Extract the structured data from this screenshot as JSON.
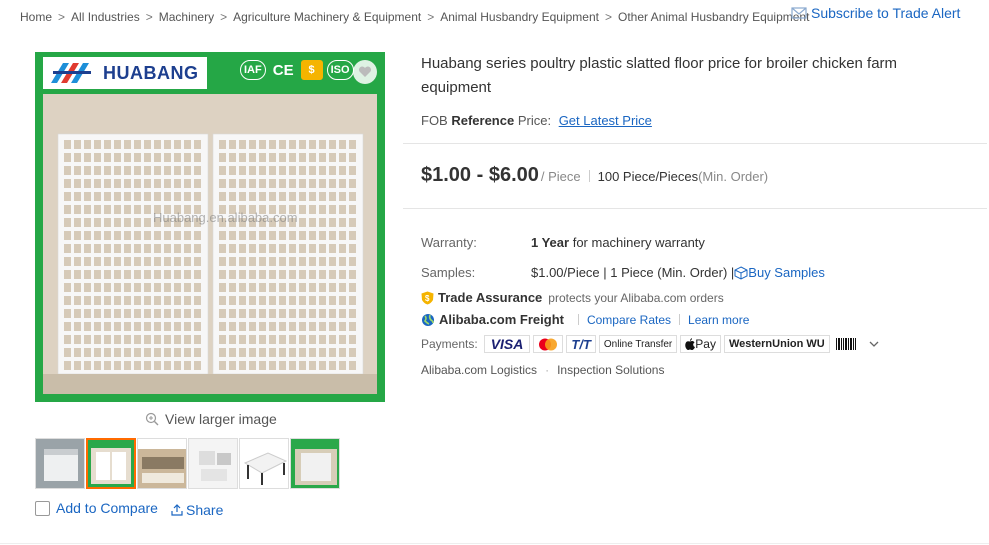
{
  "breadcrumb": {
    "items": [
      "Home",
      "All Industries",
      "Machinery",
      "Agriculture Machinery & Equipment",
      "Animal Husbandry Equipment",
      "Other Animal Husbandry Equipment"
    ],
    "separator": ">"
  },
  "subscribe": {
    "label": "Subscribe to Trade Alert",
    "icon": "mail-icon"
  },
  "gallery": {
    "brand": "HUABANG",
    "certs": [
      "IAF",
      "CE",
      "$",
      "ISO"
    ],
    "watermark": "Huabang.en.alibaba.com",
    "view_larger": "View larger image",
    "thumb_count": 6,
    "active_thumb": 1
  },
  "compare": {
    "label": "Add to Compare"
  },
  "share": {
    "label": "Share"
  },
  "product": {
    "title": "Huabang series poultry plastic slatted floor price for broiler chicken farm equipment",
    "fob_prefix": "FOB ",
    "fob_bold": "Reference",
    "fob_suffix": " Price:",
    "fob_link": "Get Latest Price",
    "price": "$1.00 - $6.00",
    "unit": "/ Piece",
    "moq": "100 Piece/Pieces",
    "moq_suffix": "(Min. Order)"
  },
  "specs": {
    "warranty_label": "Warranty:",
    "warranty_bold": "1 Year",
    "warranty_text": " for machinery warranty",
    "samples_label": "Samples:",
    "samples_text": "$1.00/Piece | 1 Piece (Min. Order) | ",
    "samples_link": "Buy Samples"
  },
  "services": {
    "trade_assurance": "Trade Assurance",
    "trade_assurance_desc": "protects your Alibaba.com orders",
    "freight": "Alibaba.com Freight",
    "compare_rates": "Compare Rates",
    "learn_more": "Learn more"
  },
  "payments": {
    "label": "Payments:",
    "methods": [
      "VISA",
      "Mastercard",
      "T/T",
      "Online Transfer",
      "Pay",
      "WesternUnion WU",
      "Boleto"
    ]
  },
  "logistics": {
    "items": [
      "Alibaba.com Logistics",
      "Inspection Solutions"
    ]
  },
  "colors": {
    "link": "#1a66c2",
    "brand_green": "#25a746",
    "accent_orange": "#ff6a00"
  }
}
